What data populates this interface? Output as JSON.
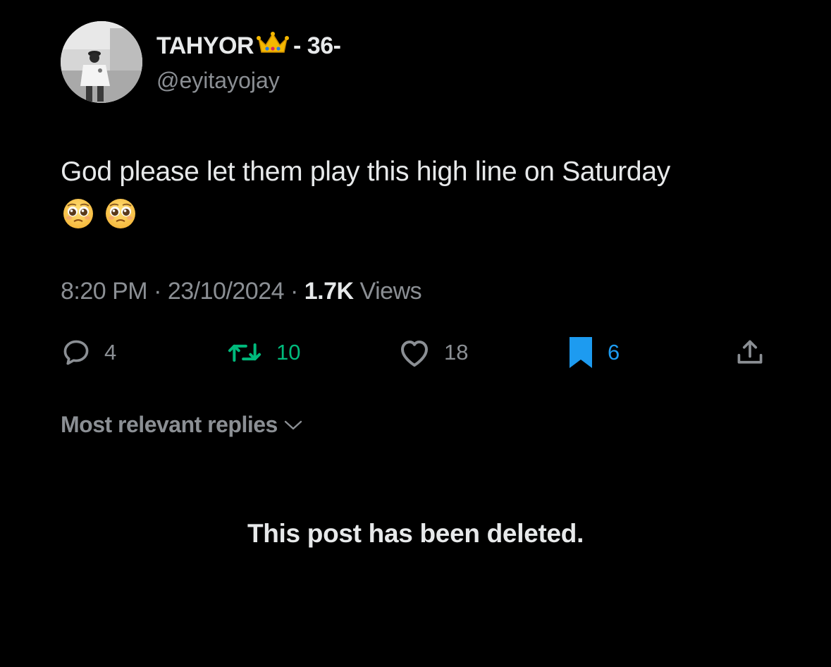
{
  "author": {
    "display_name": "TAHYOR",
    "name_suffix": "- 36-",
    "handle": "@eyitayojay",
    "badge_icon": "crown-icon"
  },
  "tweet": {
    "text": "God please let them play this high line on Saturday",
    "emojis": [
      "pleading-face-icon",
      "pleading-face-icon"
    ],
    "time": "8:20 PM",
    "date": "23/10/2024",
    "views_count": "1.7K",
    "views_label": "Views"
  },
  "actions": {
    "replies": "4",
    "reposts": "10",
    "likes": "18",
    "bookmarks": "6"
  },
  "colors": {
    "background": "#000000",
    "text_primary": "#e7e9ea",
    "text_secondary": "#8b8f94",
    "repost_active": "#00ba7c",
    "bookmark_active": "#1d9bf0"
  },
  "replies_section": {
    "sort_label": "Most relevant replies",
    "deleted_message": "This post has been deleted."
  }
}
